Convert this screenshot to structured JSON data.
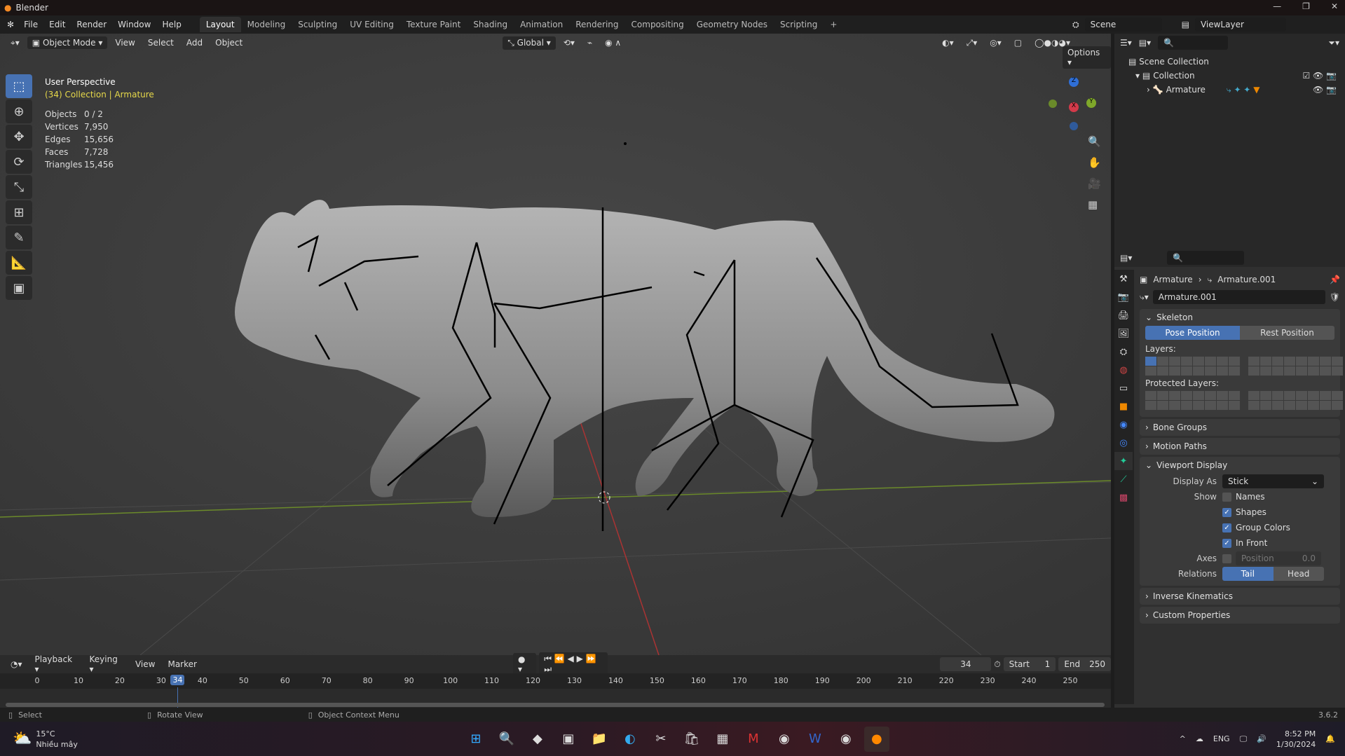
{
  "window": {
    "title": "Blender"
  },
  "menu": [
    "File",
    "Edit",
    "Render",
    "Window",
    "Help"
  ],
  "workspaces": [
    "Layout",
    "Modeling",
    "Sculpting",
    "UV Editing",
    "Texture Paint",
    "Shading",
    "Animation",
    "Rendering",
    "Compositing",
    "Geometry Nodes",
    "Scripting"
  ],
  "workspace_add": "+",
  "top_right": {
    "scene": "Scene",
    "view_layer": "ViewLayer"
  },
  "viewport": {
    "mode": "Object Mode",
    "menus": [
      "View",
      "Select",
      "Add",
      "Object"
    ],
    "orientation": "Global",
    "options": "Options",
    "perspective": "User Perspective",
    "context": "(34) Collection | Armature",
    "stats": [
      {
        "label": "Objects",
        "value": "0 / 2"
      },
      {
        "label": "Vertices",
        "value": "7,950"
      },
      {
        "label": "Edges",
        "value": "15,656"
      },
      {
        "label": "Faces",
        "value": "7,728"
      },
      {
        "label": "Triangles",
        "value": "15,456"
      }
    ],
    "gizmo": {
      "x": "X",
      "y": "Y",
      "z": "Z"
    }
  },
  "outliner": {
    "items": [
      {
        "label": "Scene Collection"
      },
      {
        "label": "Collection"
      },
      {
        "label": "Armature"
      }
    ]
  },
  "properties": {
    "breadcrumb": [
      "Armature",
      "Armature.001"
    ],
    "data_name": "Armature.001",
    "skeleton": {
      "title": "Skeleton",
      "pose": "Pose Position",
      "rest": "Rest Position",
      "layers": "Layers:",
      "protected": "Protected Layers:"
    },
    "collapsed": [
      "Bone Groups",
      "Motion Paths"
    ],
    "viewport_display": {
      "title": "Viewport Display",
      "display_as_label": "Display As",
      "display_as": "Stick",
      "show_label": "Show",
      "show": [
        {
          "label": "Names",
          "checked": false
        },
        {
          "label": "Shapes",
          "checked": true
        },
        {
          "label": "Group Colors",
          "checked": true
        },
        {
          "label": "In Front",
          "checked": true
        }
      ],
      "axes_label": "Axes",
      "axes_position_label": "Position",
      "axes_position": "0.0",
      "relations_label": "Relations",
      "tail": "Tail",
      "head": "Head"
    },
    "collapsed2": [
      "Inverse Kinematics",
      "Custom Properties"
    ]
  },
  "timeline": {
    "menus": [
      "Playback",
      "Keying",
      "View",
      "Marker"
    ],
    "current_frame": "34",
    "start_label": "Start",
    "start": "1",
    "end_label": "End",
    "end": "250",
    "ticks": [
      "0",
      "10",
      "20",
      "30",
      "40",
      "50",
      "60",
      "70",
      "80",
      "90",
      "100",
      "110",
      "120",
      "130",
      "140",
      "150",
      "160",
      "170",
      "180",
      "190",
      "200",
      "210",
      "220",
      "230",
      "240",
      "250"
    ]
  },
  "status": {
    "select": "Select",
    "rotate": "Rotate View",
    "context_menu": "Object Context Menu",
    "version": "3.6.2"
  },
  "taskbar": {
    "temp": "15°C",
    "weather": "Nhiều mây",
    "lang": "ENG",
    "time": "8:52 PM",
    "date": "1/30/2024"
  },
  "colors": {
    "accent": "#4772b3",
    "context_text": "#e6d84a"
  }
}
